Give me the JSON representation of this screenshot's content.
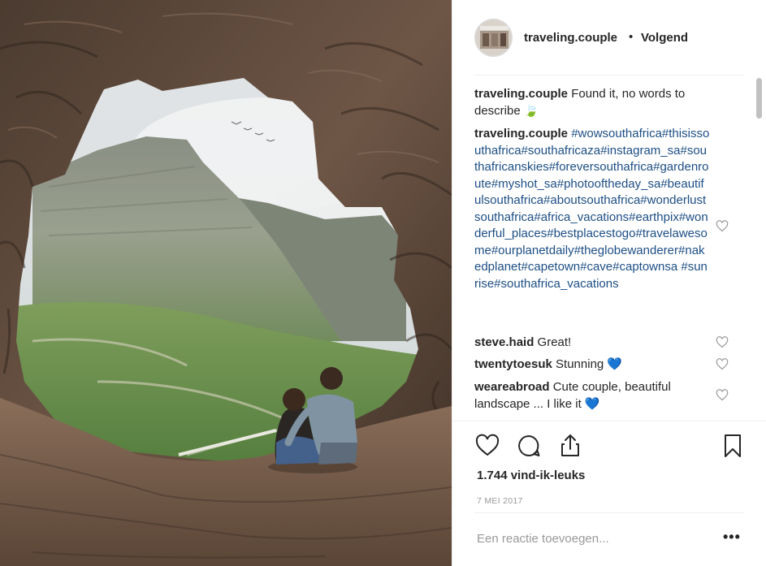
{
  "photo": {
    "subject": "couple sitting in a rock cave overlooking a mountain"
  },
  "header": {
    "username": "traveling.couple",
    "separator": "•",
    "follow_label": "Volgend"
  },
  "comments": [
    {
      "user": "traveling.couple",
      "text": "Found it, no words to describe 🍃",
      "likeable": false
    },
    {
      "user": "traveling.couple",
      "text": "#wowsouthafrica#thisissouthafrica#southafricaza#instagram_sa#southafricanskies#foreversouthafrica#gardenroute#myshot_sa#photooftheday_sa#beautifulsouthafrica#aboutsouthafrica#wonderlustsouthafrica#africa_vacations#earthpix#wonderful_places#bestplacestogo#travelawesome#ourplanetdaily#theglobewanderer#nakedplanet#capetown#cave#captownsa #sunrise#southafrica_vacations",
      "likeable": true
    },
    {
      "user": "steve.haid",
      "text": "Great!",
      "likeable": true
    },
    {
      "user": "twentytoesuk",
      "text": "Stunning 💙",
      "likeable": true
    },
    {
      "user": "weareabroad",
      "text": "Cute couple, beautiful landscape ... I like it 💙",
      "likeable": true
    }
  ],
  "actions": {
    "like_icon": "heart-outline-icon",
    "comment_icon": "comment-bubble-icon",
    "share_icon": "share-upload-icon",
    "save_icon": "bookmark-icon"
  },
  "likes": "1.744 vind-ik-leuks",
  "date": "7 MEI 2017",
  "add_comment_placeholder": "Een reactie toevoegen...",
  "more_options": "•••",
  "colors": {
    "hashtag": "#1d4e85",
    "text": "#262626",
    "muted": "#999999",
    "divider": "#efefef",
    "heart_blue": "#2f86e8"
  }
}
